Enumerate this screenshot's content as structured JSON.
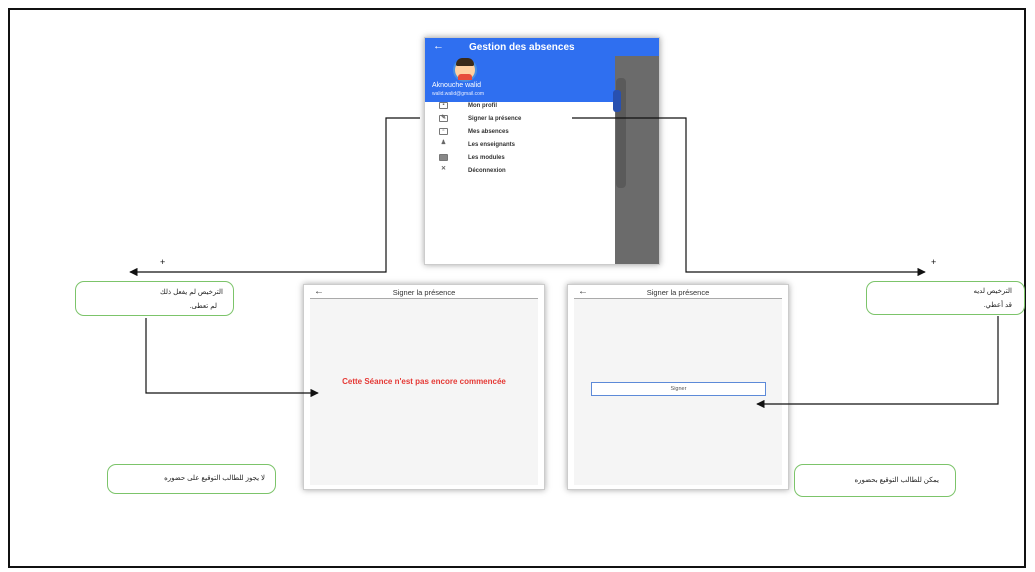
{
  "top_phone": {
    "app_title": "Gestion des absences",
    "back_icon": "arrow-left-icon",
    "user_name": "Aknouche walid",
    "user_email": "walid.walid@gmail.com",
    "menu": [
      {
        "label": "Mon profil",
        "icon": "profile-icon"
      },
      {
        "label": "Signer la présence",
        "icon": "sign-icon"
      },
      {
        "label": "Mes absences",
        "icon": "calendar-icon"
      },
      {
        "label": "Les enseignants",
        "icon": "teacher-icon"
      },
      {
        "label": "Les modules",
        "icon": "modules-icon"
      },
      {
        "label": "Déconnexion",
        "icon": "logout-icon"
      }
    ]
  },
  "left_phone": {
    "title": "Signer la présence",
    "message": "Cette Séance n'est pas encore commencée",
    "message_color": "#e53935"
  },
  "right_phone": {
    "title": "Signer la présence",
    "button_label": "Signer"
  },
  "notes": {
    "left_top_line1": "الترخيص لم يفعل ذلك",
    "left_top_line2": "لم تعطى.",
    "left_bottom": "لا يجوز للطالب التوقيع على حضوره",
    "right_top_line1": "الترخيص لديه",
    "right_top_line2": "قد أعطي.",
    "right_bottom": "يمكن للطالب التوقيع بحضوره"
  },
  "plus_sign": "+",
  "colors": {
    "app_bar": "#2f6ff0",
    "note_border": "#7cc46a"
  }
}
